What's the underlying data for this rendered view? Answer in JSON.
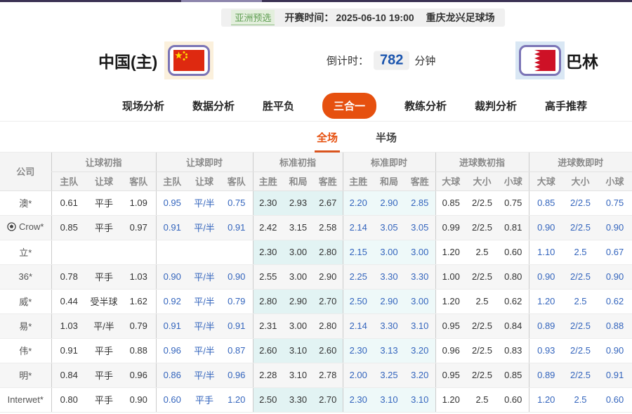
{
  "top_bar": {
    "league_badge": "亚洲预选",
    "kickoff_label": "开赛时间：",
    "kickoff_value": "2025-06-10 19:00",
    "venue": "重庆龙兴足球场"
  },
  "match": {
    "home_name": "中国(主)",
    "away_name": "巴林",
    "countdown_label": "倒计时：",
    "countdown_value": "782",
    "countdown_unit": "分钟"
  },
  "nav": {
    "items": [
      {
        "id": "live-analysis",
        "label": "现场分析",
        "active": false
      },
      {
        "id": "data-analysis",
        "label": "数据分析",
        "active": false
      },
      {
        "id": "win-draw-loss",
        "label": "胜平负",
        "active": false
      },
      {
        "id": "three-in-one",
        "label": "三合一",
        "active": true
      },
      {
        "id": "coach-analysis",
        "label": "教练分析",
        "active": false
      },
      {
        "id": "referee-analysis",
        "label": "裁判分析",
        "active": false
      },
      {
        "id": "expert-picks",
        "label": "高手推荐",
        "active": false
      }
    ]
  },
  "subtabs": {
    "items": [
      {
        "id": "full-match",
        "label": "全场",
        "active": true
      },
      {
        "id": "half-match",
        "label": "半场",
        "active": false
      }
    ]
  },
  "odds_table": {
    "company_header": "公司",
    "groups": [
      {
        "label": "让球初指",
        "cols": [
          "主队",
          "让球",
          "客队"
        ]
      },
      {
        "label": "让球即时",
        "cols": [
          "主队",
          "让球",
          "客队"
        ]
      },
      {
        "label": "标准初指",
        "cols": [
          "主胜",
          "和局",
          "客胜"
        ]
      },
      {
        "label": "标准即时",
        "cols": [
          "主胜",
          "和局",
          "客胜"
        ]
      },
      {
        "label": "进球数初指",
        "cols": [
          "大球",
          "大小",
          "小球"
        ]
      },
      {
        "label": "进球数即时",
        "cols": [
          "大球",
          "大小",
          "小球"
        ]
      }
    ],
    "rows": [
      {
        "company": "澳*",
        "icon": null,
        "cells": [
          "0.61",
          "平手",
          "1.09",
          "0.95",
          "平/半",
          "0.75",
          "2.30",
          "2.93",
          "2.67",
          "2.20",
          "2.90",
          "2.85",
          "0.85",
          "2/2.5",
          "0.75",
          "0.85",
          "2/2.5",
          "0.75"
        ]
      },
      {
        "company": "Crow*",
        "icon": "soccer-ball",
        "cells": [
          "0.85",
          "平手",
          "0.97",
          "0.91",
          "平/半",
          "0.91",
          "2.42",
          "3.15",
          "2.58",
          "2.14",
          "3.05",
          "3.05",
          "0.99",
          "2/2.5",
          "0.81",
          "0.90",
          "2/2.5",
          "0.90"
        ]
      },
      {
        "company": "立*",
        "icon": null,
        "cells": [
          "",
          "",
          "",
          "",
          "",
          "",
          "2.30",
          "3.00",
          "2.80",
          "2.15",
          "3.00",
          "3.00",
          "1.20",
          "2.5",
          "0.60",
          "1.10",
          "2.5",
          "0.67"
        ]
      },
      {
        "company": "36*",
        "icon": null,
        "cells": [
          "0.78",
          "平手",
          "1.03",
          "0.90",
          "平/半",
          "0.90",
          "2.55",
          "3.00",
          "2.90",
          "2.25",
          "3.30",
          "3.30",
          "1.00",
          "2/2.5",
          "0.80",
          "0.90",
          "2/2.5",
          "0.90"
        ]
      },
      {
        "company": "威*",
        "icon": null,
        "cells": [
          "0.44",
          "受半球",
          "1.62",
          "0.92",
          "平/半",
          "0.79",
          "2.80",
          "2.90",
          "2.70",
          "2.50",
          "2.90",
          "3.00",
          "1.20",
          "2.5",
          "0.62",
          "1.20",
          "2.5",
          "0.62"
        ]
      },
      {
        "company": "易*",
        "icon": null,
        "cells": [
          "1.03",
          "平/半",
          "0.79",
          "0.91",
          "平/半",
          "0.91",
          "2.31",
          "3.00",
          "2.80",
          "2.14",
          "3.30",
          "3.10",
          "0.95",
          "2/2.5",
          "0.84",
          "0.89",
          "2/2.5",
          "0.88"
        ]
      },
      {
        "company": "伟*",
        "icon": null,
        "cells": [
          "0.91",
          "平手",
          "0.88",
          "0.96",
          "平/半",
          "0.87",
          "2.60",
          "3.10",
          "2.60",
          "2.30",
          "3.13",
          "3.20",
          "0.96",
          "2/2.5",
          "0.83",
          "0.93",
          "2/2.5",
          "0.90"
        ]
      },
      {
        "company": "明*",
        "icon": null,
        "cells": [
          "0.84",
          "平手",
          "0.96",
          "0.86",
          "平/半",
          "0.96",
          "2.28",
          "3.10",
          "2.78",
          "2.00",
          "3.25",
          "3.20",
          "0.95",
          "2/2.5",
          "0.85",
          "0.89",
          "2/2.5",
          "0.91"
        ]
      },
      {
        "company": "Interwet*",
        "icon": null,
        "cells": [
          "0.80",
          "平手",
          "0.90",
          "0.60",
          "平手",
          "1.20",
          "2.50",
          "3.30",
          "2.70",
          "2.30",
          "3.10",
          "3.10",
          "1.20",
          "2.5",
          "0.60",
          "1.20",
          "2.5",
          "0.60"
        ]
      }
    ]
  },
  "colors": {
    "accent_orange": "#e6500f",
    "live_odds_blue": "#3465bd",
    "initial_std_bg": "#e2f3f3",
    "live_std_bg": "#eef9f9",
    "countdown_blue": "#1b55ae",
    "badge_green": "#5f9e52",
    "top_strip_purple": "#3b3254"
  }
}
